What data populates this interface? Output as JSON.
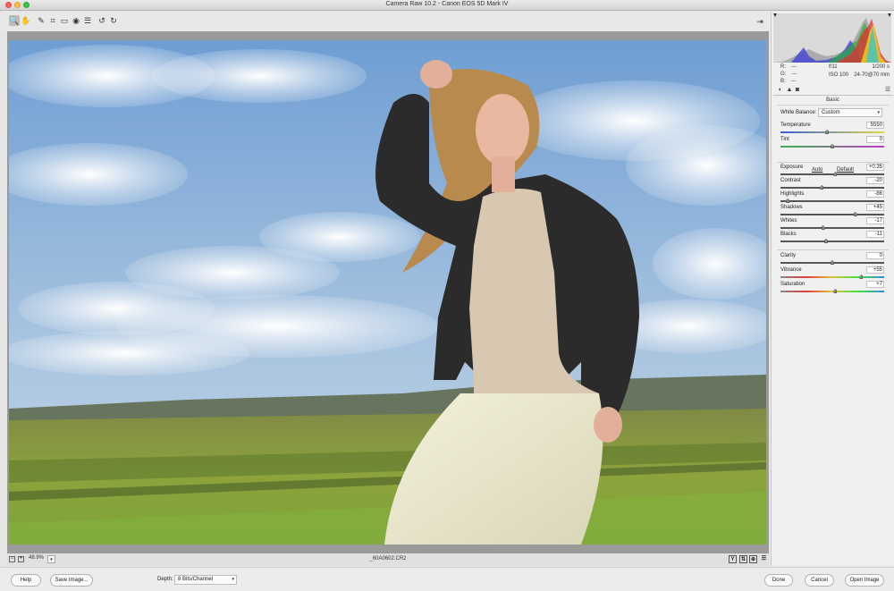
{
  "window": {
    "title": "Camera Raw 10.2  -  Canon EOS 5D Mark IV"
  },
  "toolbar": {
    "tools": [
      {
        "name": "zoom-tool",
        "glyph": "🔍",
        "active": true
      },
      {
        "name": "hand-tool",
        "glyph": "✋",
        "active": false
      },
      {
        "name": "white-balance-tool",
        "glyph": "✎",
        "active": false
      },
      {
        "name": "crop-tool",
        "glyph": "⌗",
        "active": false
      },
      {
        "name": "straighten-tool",
        "glyph": "▭",
        "active": false
      },
      {
        "name": "redeye-tool",
        "glyph": "◉",
        "active": false
      },
      {
        "name": "preferences-tool",
        "glyph": "☰",
        "active": false
      },
      {
        "name": "rotate-left-tool",
        "glyph": "↺",
        "active": false
      },
      {
        "name": "rotate-right-tool",
        "glyph": "↻",
        "active": false
      }
    ]
  },
  "status": {
    "zoom": "48.9%",
    "filename": "_60A0602.CR2"
  },
  "panel": {
    "rgb": {
      "r_label": "R:",
      "g_label": "G:",
      "b_label": "B:",
      "r": "---",
      "g": "---",
      "b": "---"
    },
    "camera": {
      "aperture": "f/11",
      "shutter": "1/200 s",
      "iso": "ISO 100",
      "lens": "24-70@70 mm"
    },
    "section_title": "Basic",
    "white_balance": {
      "label": "White Balance:",
      "value": "Custom"
    },
    "links": {
      "auto": "Auto",
      "default": "Default"
    },
    "sliders_wb": [
      {
        "label": "Temperature",
        "value": "5550",
        "position": 0.45,
        "gradient": "temp"
      },
      {
        "label": "Tint",
        "value": "0",
        "position": 0.5,
        "gradient": "tint"
      }
    ],
    "sliders_tone": [
      {
        "label": "Exposure",
        "value": "+0.35",
        "position": 0.53
      },
      {
        "label": "Contrast",
        "value": "-20",
        "position": 0.4
      },
      {
        "label": "Highlights",
        "value": "-86",
        "position": 0.07
      },
      {
        "label": "Shadows",
        "value": "+45",
        "position": 0.72
      },
      {
        "label": "Whites",
        "value": "-17",
        "position": 0.41
      },
      {
        "label": "Blacks",
        "value": "-11",
        "position": 0.44
      }
    ],
    "sliders_presence": [
      {
        "label": "Clarity",
        "value": "0",
        "position": 0.5
      },
      {
        "label": "Vibrance",
        "value": "+55",
        "position": 0.78,
        "gradient": "vib"
      },
      {
        "label": "Saturation",
        "value": "+7",
        "position": 0.53,
        "gradient": "sat"
      }
    ]
  },
  "bottom": {
    "help": "Help",
    "save": "Save Image...",
    "depth_label": "Depth:",
    "depth_value": "8 Bits/Channel",
    "done": "Done",
    "cancel": "Cancel",
    "open": "Open Image"
  }
}
